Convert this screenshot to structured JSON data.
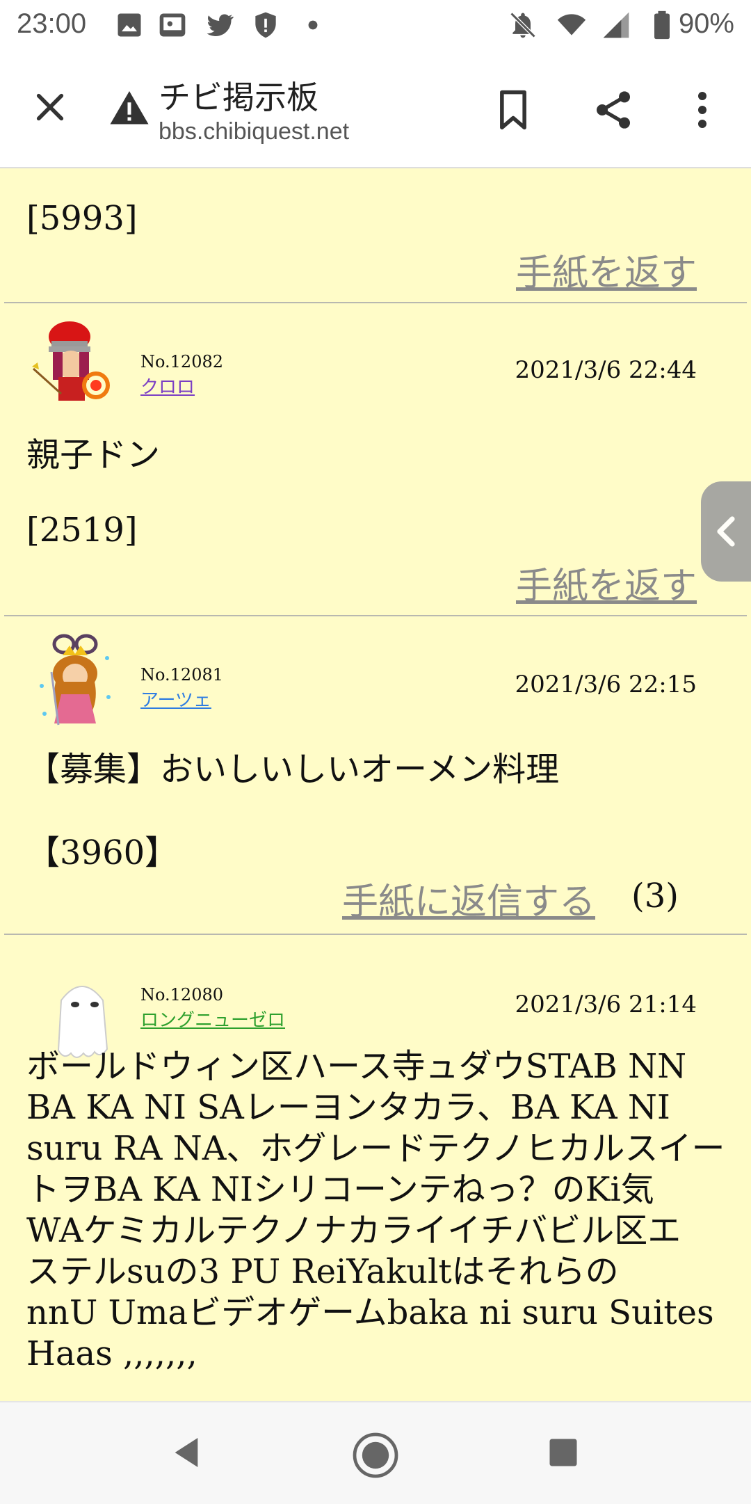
{
  "status_bar": {
    "time": "23:00",
    "battery": "90%",
    "left_icons": [
      "image-icon",
      "game-icon",
      "twitter-icon",
      "alert-icon",
      "dot-icon"
    ],
    "right_icons": [
      "mute-icon",
      "wifi-icon",
      "signal-icon",
      "battery-icon"
    ]
  },
  "toolbar": {
    "title": "チビ掲示板",
    "url": "bbs.chibiquest.net"
  },
  "posts": [
    {
      "body_tail": "[5993]",
      "reply_label": "手紙を返す"
    },
    {
      "number": "No.12082",
      "author": "クロロ",
      "author_color": "#7b3fc4",
      "date": "2021/3/6 22:44",
      "body_line1": "親子ドン",
      "body_line2": "[2519]",
      "reply_label": "手紙を返す"
    },
    {
      "number": "No.12081",
      "author": "アーツェ",
      "author_color": "#2f7de1",
      "date": "2021/3/6 22:15",
      "body_line1": "【募集】おいしいしいオーメン料理",
      "body_line2": "【3960】",
      "reply_label": "手紙に返信する",
      "reply_count": "(3)"
    },
    {
      "number": "No.12080",
      "author": "ロングニューゼロ",
      "author_color": "#2ea02e",
      "date": "2021/3/6 21:14",
      "body_lines": [
        "ボールドウィン区ハース寺ュダウSTAB NN",
        "BA KA NI SAレーヨンタカラ、BA KA NI",
        "suru RA NA、ホグレードテクノヒカルスイー",
        "トヲBA KA NIシリコーンテねっ？のKi気",
        "WAケミカルテクノナカライイチバビル区エ",
        "ステルsuの3 PU ReiYakultはそれらの",
        "nnU Umaビデオゲームbaka ni suru Suites",
        "Haas ,,,,,,,"
      ]
    }
  ],
  "colors": {
    "page_background": "#fffcc8",
    "link_gray": "#8a8a8a"
  }
}
